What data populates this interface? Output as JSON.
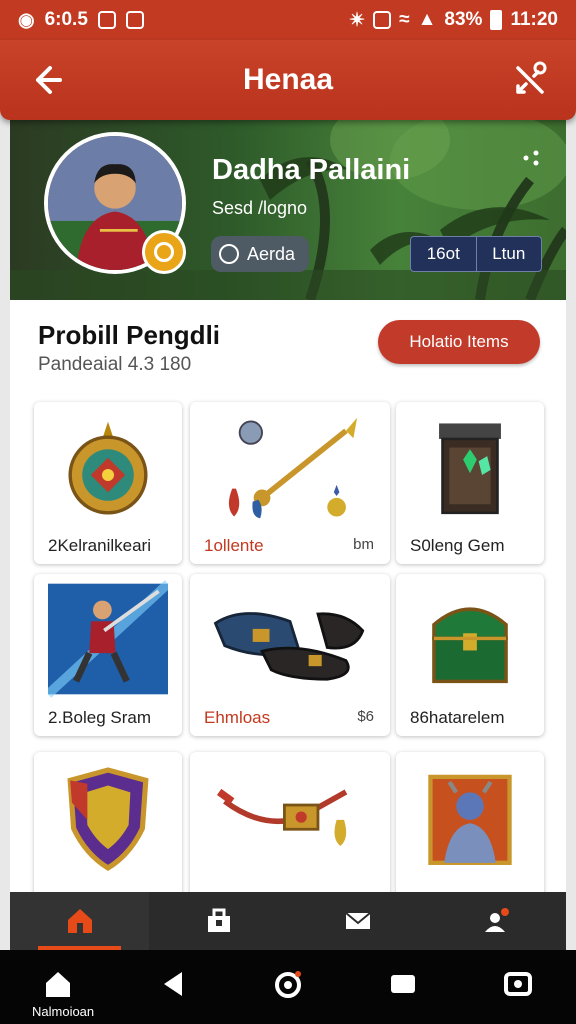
{
  "status_bar": {
    "time": "6:0.5",
    "battery": "83%",
    "clock": "11:20"
  },
  "app_bar": {
    "title": "Henaa"
  },
  "profile": {
    "name": "Dadha Pallaini",
    "subtitle": "Sesd /logno",
    "role": "Aerda",
    "stat_left": "16ot",
    "stat_right": "Ltun"
  },
  "section": {
    "title": "Probill Pengdli",
    "subtitle": "Pandeaial 4.3 180",
    "items_button": "Holatio Items"
  },
  "items": [
    {
      "label": "2Kelranilkeari",
      "value": "",
      "icon": "medallion-icon"
    },
    {
      "label": "1ollente",
      "value": "bm",
      "icon": "staff-icon"
    },
    {
      "label": "S0leng Gem",
      "value": "",
      "icon": "gem-chest-icon"
    },
    {
      "label": "2.Boleg Sram",
      "value": "",
      "icon": "warrior-portrait-icon"
    },
    {
      "label": "Ehmloas",
      "value": "$6",
      "icon": "boots-icon"
    },
    {
      "label": "86hatarelem",
      "value": "",
      "icon": "treasure-chest-icon"
    },
    {
      "label": "",
      "value": "",
      "icon": "shield-icon"
    },
    {
      "label": "",
      "value": "",
      "icon": "amulet-icon"
    },
    {
      "label": "",
      "value": "",
      "icon": "hero-card-icon"
    }
  ],
  "bottom_nav": [
    "home-icon",
    "store-icon",
    "mail-icon",
    "profile-icon"
  ],
  "system_bar": {
    "home_label": "Nalmoioan"
  },
  "colors": {
    "primary": "#c23a22",
    "accent": "#e64a19",
    "nav_bg": "#2b2b2b"
  }
}
